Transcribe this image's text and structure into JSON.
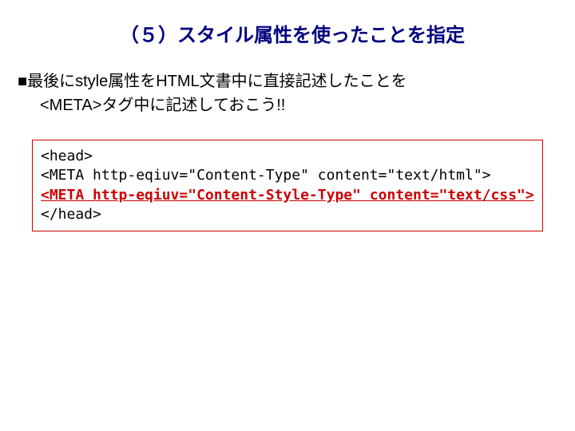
{
  "heading": "（５）スタイル属性を使ったことを指定",
  "body": {
    "line1": "■最後にstyle属性をHTML文書中に直接記述したことを",
    "line2": "<META>タグ中に記述しておこう!!"
  },
  "code": {
    "l1": "<head>",
    "l2": "<META http-eqiuv=\"Content-Type\" content=\"text/html\">",
    "l3": "<META http-eqiuv=\"Content-Style-Type\" content=\"text/css\">",
    "l4": "</head>"
  }
}
